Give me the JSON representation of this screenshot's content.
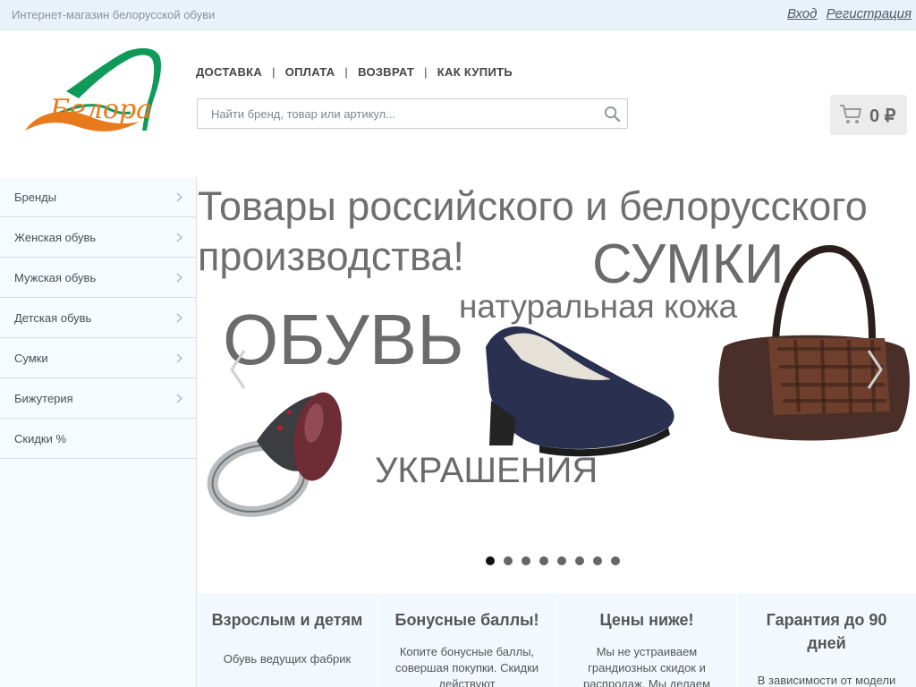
{
  "topbar": {
    "tagline": "Интернет-магазин белорусской обуви",
    "login": "Вход",
    "register": "Регистрация"
  },
  "logo": {
    "text": "Белора",
    "colors": {
      "green": "#0f9a5a",
      "orange": "#e87a1c"
    }
  },
  "nav": [
    "ДОСТАВКА",
    "ОПЛАТА",
    "ВОЗВРАТ",
    "КАК КУПИТЬ"
  ],
  "search": {
    "placeholder": "Найти бренд, товар или артикул...",
    "value": ""
  },
  "cart": {
    "sum": "0 ₽"
  },
  "sidebar": {
    "items": [
      {
        "label": "Бренды",
        "has_arrow": true
      },
      {
        "label": "Женская обувь",
        "has_arrow": true
      },
      {
        "label": "Мужская обувь",
        "has_arrow": true
      },
      {
        "label": "Детская обувь",
        "has_arrow": true
      },
      {
        "label": "Сумки",
        "has_arrow": true
      },
      {
        "label": "Бижутерия",
        "has_arrow": true
      },
      {
        "label": "Скидки %",
        "has_arrow": false
      }
    ]
  },
  "slider": {
    "headline_line1": "Товары российского и белорусского",
    "headline_line2": "производства!",
    "bags": "СУМКИ",
    "leather": "натуральная кожа",
    "shoes": "ОБУВЬ",
    "jewelry": "УКРАШЕНИЯ",
    "slide_count": 8,
    "active_slide": 1
  },
  "features": [
    {
      "title": "Взрослым и детям",
      "text": "Обувь ведущих фабрик"
    },
    {
      "title": "Бонусные баллы!",
      "text": "Копите бонусные баллы, совершая покупки. Скидки действуют"
    },
    {
      "title": "Цены ниже!",
      "text": "Мы не устраиваем грандиозных скидок и распродаж. Мы делаем"
    },
    {
      "title": "Гарантия до 90 дней",
      "text": "В зависимости от модели"
    }
  ]
}
